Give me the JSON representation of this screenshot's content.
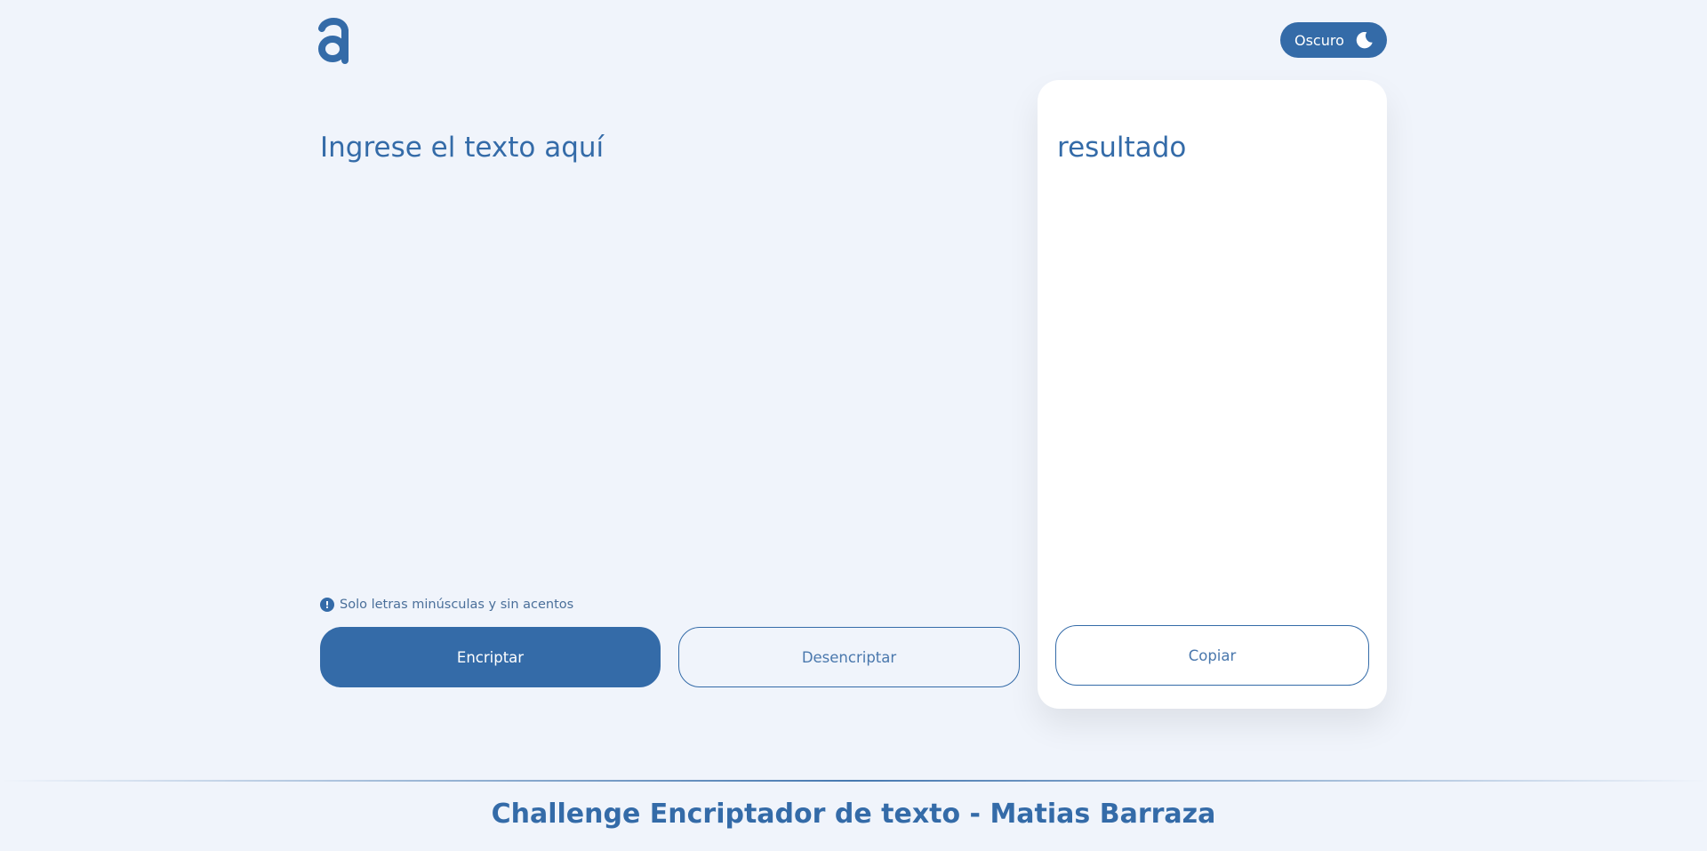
{
  "header": {
    "logo_icon": "alura-a-logo-icon",
    "theme_toggle": {
      "label": "Oscuro",
      "icon": "moon-icon"
    }
  },
  "input": {
    "placeholder": "Ingrese el texto aquí",
    "value": ""
  },
  "hint": {
    "icon": "exclamation-circle-icon",
    "text": "Solo letras minúsculas y sin acentos"
  },
  "actions": {
    "encrypt_label": "Encriptar",
    "decrypt_label": "Desencriptar"
  },
  "result": {
    "text": "resultado",
    "copy_label": "Copiar"
  },
  "footer": {
    "title": "Challenge Encriptador de texto - Matias Barraza"
  },
  "colors": {
    "accent": "#346ba8",
    "background": "#f0f4fb",
    "card": "#ffffff"
  }
}
